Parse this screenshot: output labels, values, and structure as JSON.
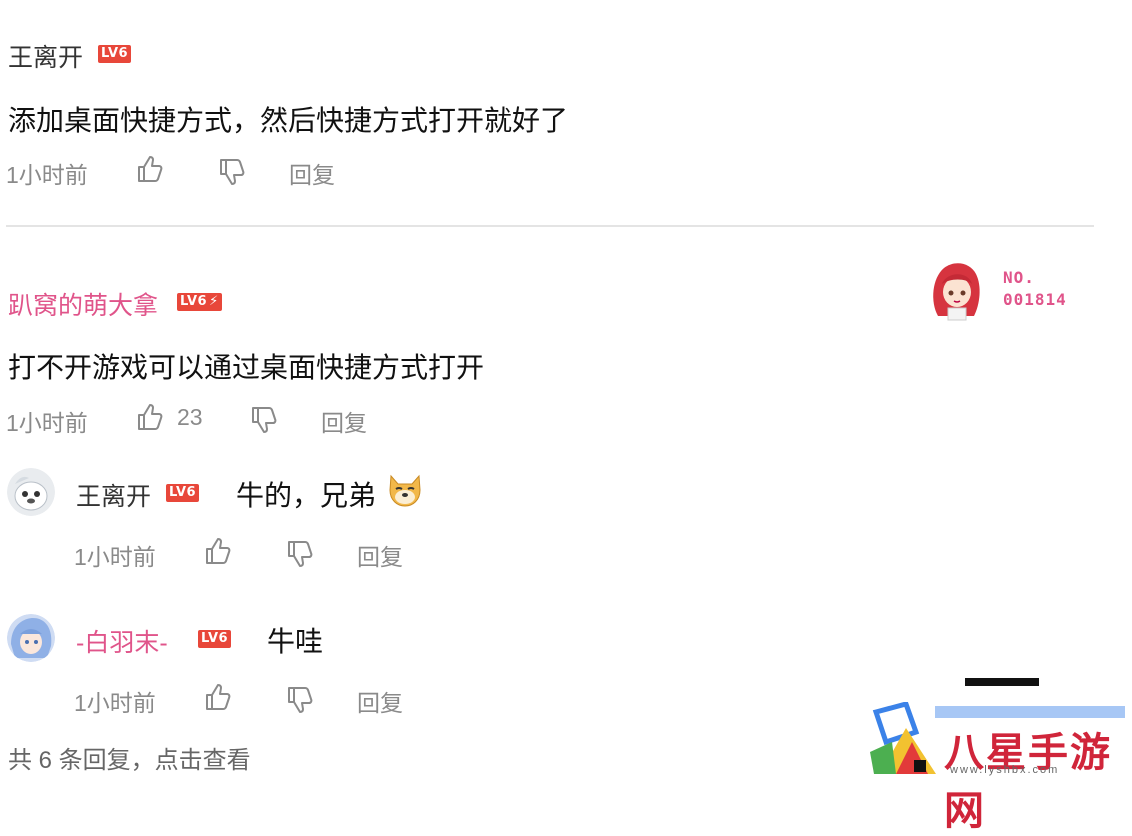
{
  "comment1": {
    "username": "王离开",
    "level": "LV6",
    "text": "添加桌面快捷方式，然后快捷方式打开就好了",
    "time": "1小时前",
    "reply_label": "回复"
  },
  "comment2": {
    "username": "趴窝的萌大拿",
    "level": "LV6",
    "text": "打不开游戏可以通过桌面快捷方式打开",
    "time": "1小时前",
    "like_count": "23",
    "reply_label": "回复",
    "card_number_line1": "NO.",
    "card_number_line2": "001814",
    "replies": [
      {
        "username": "王离开",
        "level": "LV6",
        "text": "牛的，兄弟",
        "time": "1小时前",
        "reply_label": "回复"
      },
      {
        "username": "-白羽末-",
        "level": "LV6",
        "text": "牛哇",
        "time": "1小时前",
        "reply_label": "回复"
      }
    ],
    "more_replies": "共 6 条回复，点击查看"
  },
  "watermark": {
    "text": "八星手游网",
    "url": "www.lyshbx.com"
  },
  "colors": {
    "accent_pink": "#e0548a",
    "badge_red": "#e8473a",
    "meta_gray": "#8a8a8a"
  },
  "icons": [
    "thumbs-up-icon",
    "thumbs-down-icon",
    "doge-emoji-icon"
  ]
}
